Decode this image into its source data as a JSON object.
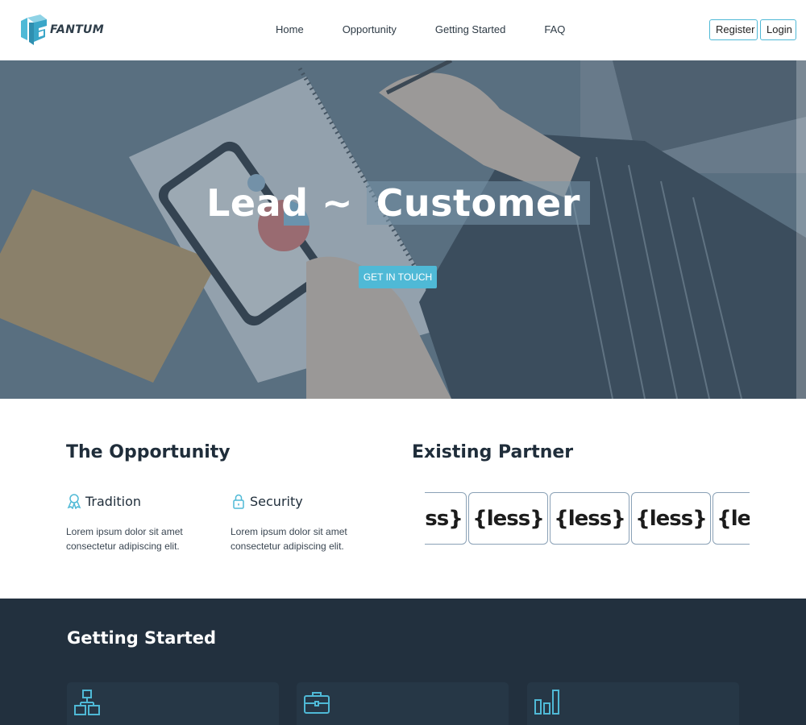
{
  "brand": {
    "name": "FANTUM",
    "colors": {
      "accent": "#4fb9d6",
      "dark": "#22303e",
      "text": "#1f2d3a"
    }
  },
  "nav": {
    "links": [
      "Home",
      "Opportunity",
      "Getting Started",
      "FAQ"
    ],
    "register": "Register",
    "login": "Login"
  },
  "hero": {
    "title_part1": "Lead ~ ",
    "title_part2": "Customer",
    "cta": "GET IN TOUCH"
  },
  "opportunity": {
    "title": "The Opportunity",
    "features": [
      {
        "icon": "award-icon",
        "name": "Tradition",
        "desc": "Lorem ipsum dolor sit amet consectetur adipiscing elit."
      },
      {
        "icon": "lock-icon",
        "name": "Security",
        "desc": "Lorem ipsum dolor sit amet consectetur adipiscing elit."
      }
    ]
  },
  "partners": {
    "title": "Existing Partner",
    "logos": [
      "{less}",
      "{less}",
      "{less}",
      "{less}",
      "{less}"
    ]
  },
  "getting_started": {
    "title": "Getting Started",
    "cards": [
      {
        "icon": "sitemap-icon"
      },
      {
        "icon": "briefcase-icon"
      },
      {
        "icon": "bar-chart-icon"
      }
    ]
  }
}
